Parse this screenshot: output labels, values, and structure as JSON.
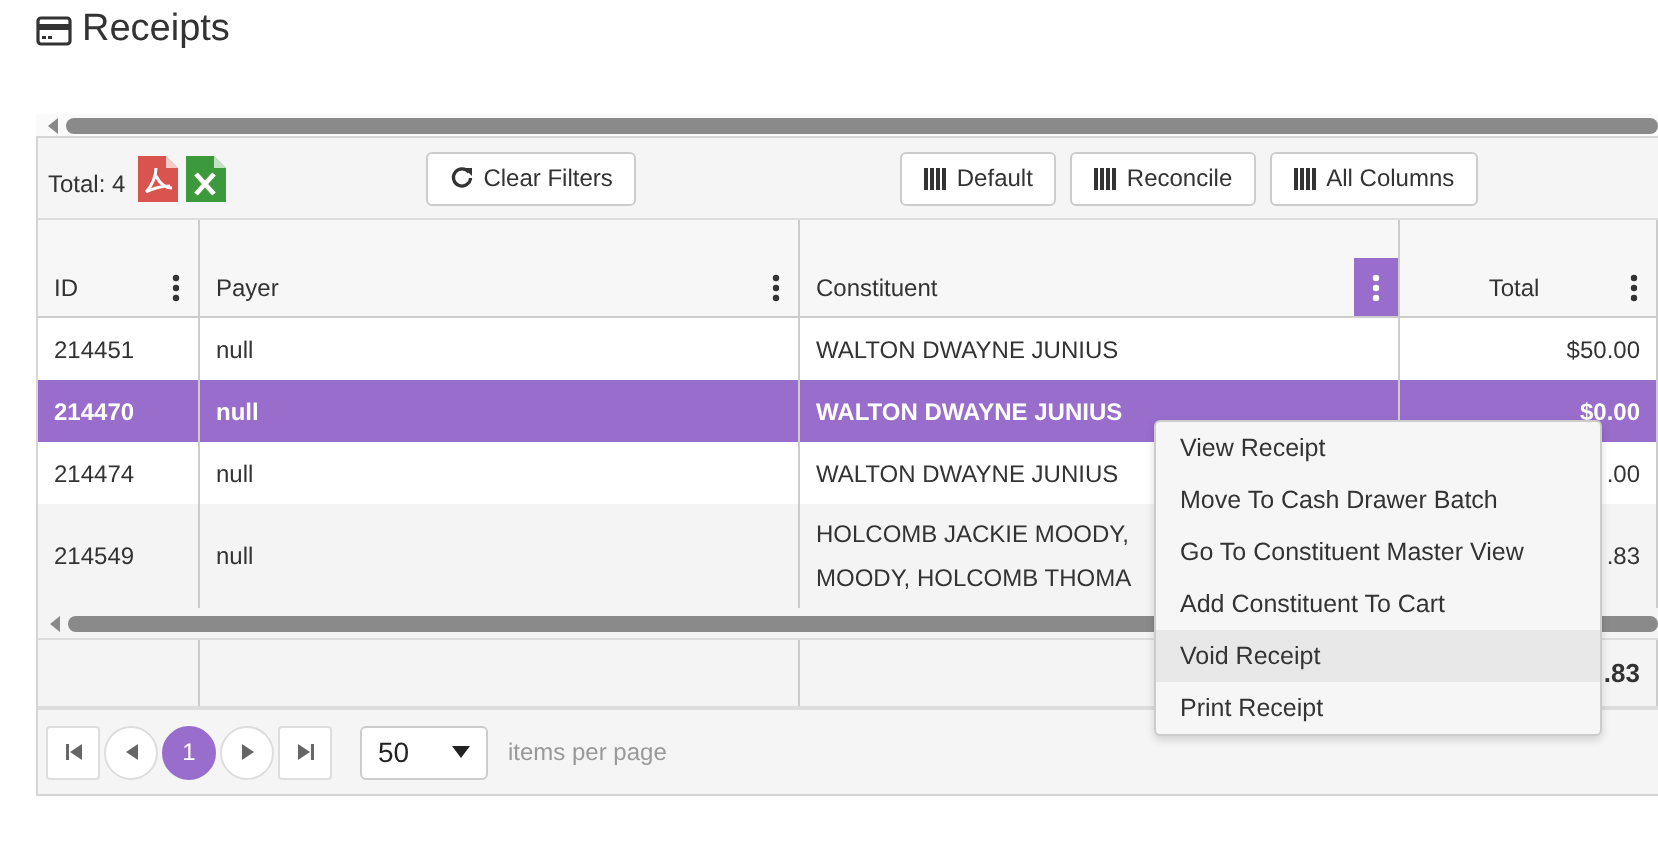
{
  "page": {
    "title": "Receipts"
  },
  "toolbar": {
    "total": "Total: 4",
    "buttons": [
      {
        "label": "Clear Filters",
        "kind": "refresh"
      },
      {
        "label": "Default",
        "kind": "columns"
      },
      {
        "label": "Reconcile",
        "kind": "columns"
      },
      {
        "label": "All Columns",
        "kind": "columns"
      }
    ]
  },
  "table": {
    "columns": [
      {
        "label": "ID",
        "menu_open": false
      },
      {
        "label": "Payer",
        "menu_open": false
      },
      {
        "label": "Constituent",
        "menu_open": true
      },
      {
        "label": "Total",
        "menu_open": false
      }
    ],
    "rows": [
      {
        "selected": false,
        "cells": [
          [
            "214451"
          ],
          [
            "null"
          ],
          [
            "WALTON DWAYNE JUNIUS"
          ],
          [
            "$50.00"
          ]
        ]
      },
      {
        "selected": true,
        "cells": [
          [
            "214470"
          ],
          [
            "null"
          ],
          [
            "WALTON DWAYNE JUNIUS"
          ],
          [
            "$0.00"
          ]
        ]
      },
      {
        "selected": false,
        "cells": [
          [
            "214474"
          ],
          [
            "null"
          ],
          [
            "WALTON DWAYNE JUNIUS"
          ],
          [
            ".00"
          ]
        ]
      },
      {
        "selected": false,
        "cells": [
          [
            "214549"
          ],
          [
            "null"
          ],
          [
            "HOLCOMB JACKIE MOODY,",
            "MOODY, HOLCOMB THOMA"
          ],
          [
            ".83"
          ]
        ]
      }
    ],
    "footer": {
      "total": ".83"
    }
  },
  "pager": {
    "pages": [
      {
        "label": "1",
        "selected": true
      }
    ],
    "page_size": "50",
    "page_size_label": "items per page"
  },
  "context_menu": [
    {
      "label": "View Receipt",
      "selected": false
    },
    {
      "label": "Move To Cash Drawer Batch",
      "selected": false
    },
    {
      "label": "Go To Constituent Master View",
      "selected": false
    },
    {
      "label": "Add Constituent To Cart",
      "selected": false
    },
    {
      "label": "Void Receipt",
      "selected": true
    },
    {
      "label": "Print Receipt",
      "selected": false
    }
  ]
}
